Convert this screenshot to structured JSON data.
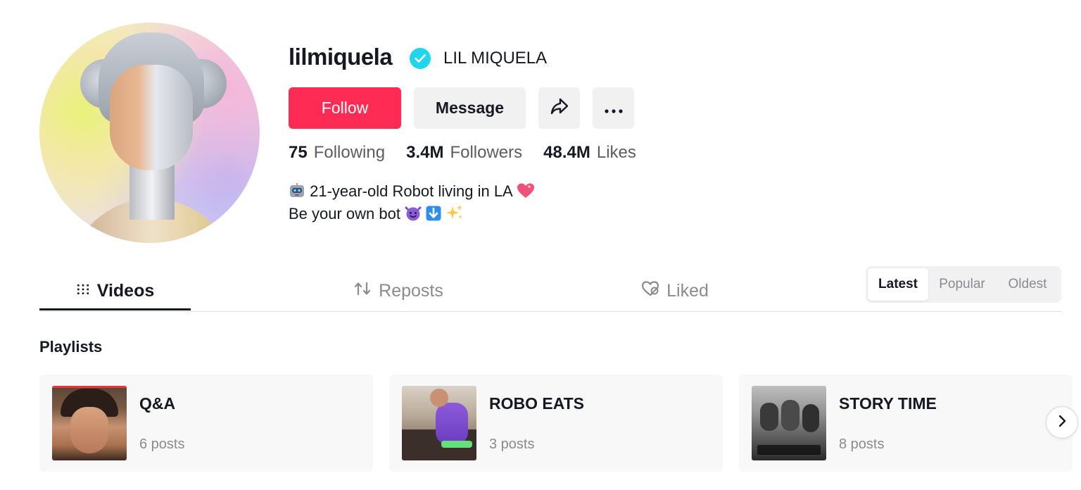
{
  "profile": {
    "username": "lilmiquela",
    "display_name": "LIL MIQUELA",
    "verified": true
  },
  "actions": {
    "follow_label": "Follow",
    "message_label": "Message",
    "share_icon": "share-icon",
    "more_icon": "more-icon"
  },
  "stats": [
    {
      "value": "75",
      "label": "Following"
    },
    {
      "value": "3.4M",
      "label": "Followers"
    },
    {
      "value": "48.4M",
      "label": "Likes"
    }
  ],
  "bio": {
    "line1": "21-year-old Robot living in LA",
    "line2": "Be your own bot",
    "line1_emoji_start": "robot-emoji",
    "line1_emoji_end": "heart-emoji",
    "line2_emojis": [
      "smiling-imp-emoji",
      "down-arrow-emoji",
      "sparkles-emoji"
    ]
  },
  "tabs": [
    {
      "label": "Videos",
      "icon": "grid-icon",
      "active": true
    },
    {
      "label": "Reposts",
      "icon": "repost-icon",
      "active": false
    },
    {
      "label": "Liked",
      "icon": "liked-heart-icon",
      "active": false
    }
  ],
  "sort": {
    "options": [
      "Latest",
      "Popular",
      "Oldest"
    ],
    "selected": "Latest"
  },
  "playlists": {
    "title": "Playlists",
    "items": [
      {
        "title": "Q&A",
        "posts": "6 posts"
      },
      {
        "title": "ROBO EATS",
        "posts": "3 posts"
      },
      {
        "title": "STORY TIME",
        "posts": "8 posts"
      }
    ],
    "next_icon": "chevron-right-icon"
  },
  "colors": {
    "brand": "#fe2c55",
    "verified": "#20d5ec",
    "text": "#161823",
    "muted": "#8a8b91"
  }
}
